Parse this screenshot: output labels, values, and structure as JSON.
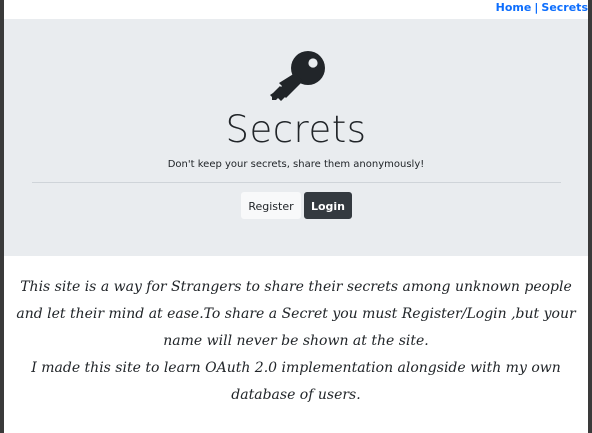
{
  "nav": {
    "home_label": "Home",
    "separator": "|",
    "secrets_label": "Secrets"
  },
  "hero": {
    "icon": "key-icon",
    "title": "Secrets",
    "subtitle": "Don't keep your secrets, share them anonymously!",
    "register_label": "Register",
    "login_label": "Login"
  },
  "about": {
    "paragraph1": "This site is a way for Strangers to share their secrets among unknown people and let their mind at ease.To share a Secret you must Register/Login ,but your name will never be shown at the site.",
    "paragraph2": "I made this site to learn OAuth 2.0 implementation alongside with my own database of users."
  },
  "colors": {
    "link": "#0d6efd",
    "jumbotron_bg": "#e9ecef",
    "login_bg": "#343a40",
    "register_bg": "#f8f9fa",
    "text": "#212529"
  }
}
